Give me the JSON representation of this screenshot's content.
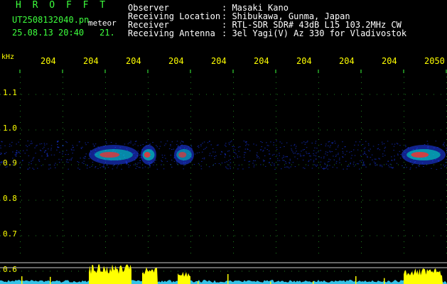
{
  "header": {
    "brand": "H R O F F T",
    "filename": "UT2508132040.pn",
    "meteor_tag": "meteor",
    "datetime": "25.08.13 20:40",
    "date_number": "21."
  },
  "info": [
    {
      "label": "Observer",
      "value": ": Masaki Kano"
    },
    {
      "label": "Receiving Location",
      "value": ": Shibukawa, Gunma, Japan"
    },
    {
      "label": "Receiver",
      "value": ": RTL-SDR SDR# 43dB L15 103.2MHz CW"
    },
    {
      "label": "Receiving Antenna",
      "value": ": 3el Yagi(V) Az 330 for Vladivostok"
    }
  ],
  "spectrogram": {
    "y_unit": "kHz",
    "y_ticks": [
      "1.1",
      "1.0",
      "0.9",
      "0.8",
      "0.7",
      "0.6"
    ],
    "x_ticks": [
      "204",
      "204",
      "204",
      "204",
      "204",
      "204",
      "204",
      "204",
      "204",
      "2050"
    ],
    "colors": {
      "background": "#000000",
      "ticks": "#3dff3d",
      "time_labels": "#ffff00",
      "signal_level": "#ffff00",
      "noise_floor": "#3ad7ff"
    }
  }
}
